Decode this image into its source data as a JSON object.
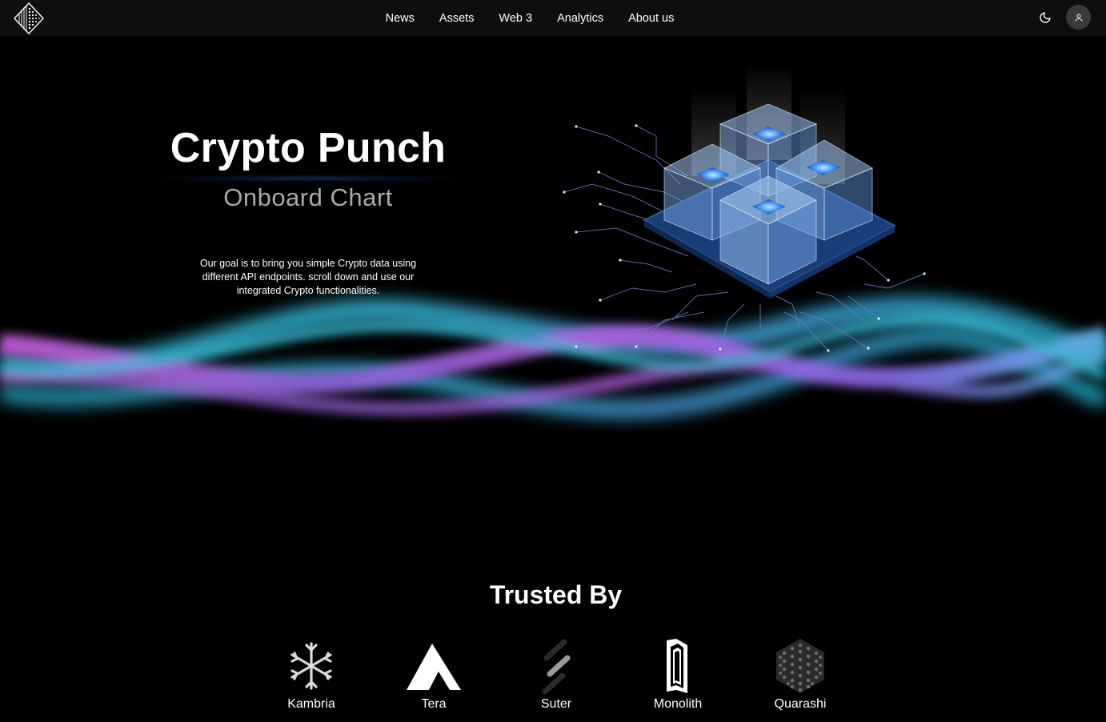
{
  "nav": {
    "items": [
      {
        "label": "News"
      },
      {
        "label": "Assets"
      },
      {
        "label": "Web 3"
      },
      {
        "label": "Analytics"
      },
      {
        "label": "About us"
      }
    ],
    "theme_icon": "moon-icon",
    "user_icon": "user-icon"
  },
  "hero": {
    "title": "Crypto Punch",
    "subtitle": "Onboard Chart",
    "description": "Our goal is to bring you simple Crypto data using different API endpoints. scroll down and use our integrated Crypto functionalities."
  },
  "trusted": {
    "title": "Trusted By",
    "brands": [
      {
        "name": "Kambria",
        "icon": "kambria-logo"
      },
      {
        "name": "Tera",
        "icon": "tera-logo"
      },
      {
        "name": "Suter",
        "icon": "suter-logo"
      },
      {
        "name": "Monolith",
        "icon": "monolith-logo"
      },
      {
        "name": "Quarashi",
        "icon": "quarashi-logo"
      }
    ]
  },
  "colors": {
    "background": "#000000",
    "topbar": "#0e0e0e",
    "wave_pink": "#c45ee0",
    "wave_cyan": "#2fb8d8",
    "chip_blue": "#6fa8e8"
  }
}
